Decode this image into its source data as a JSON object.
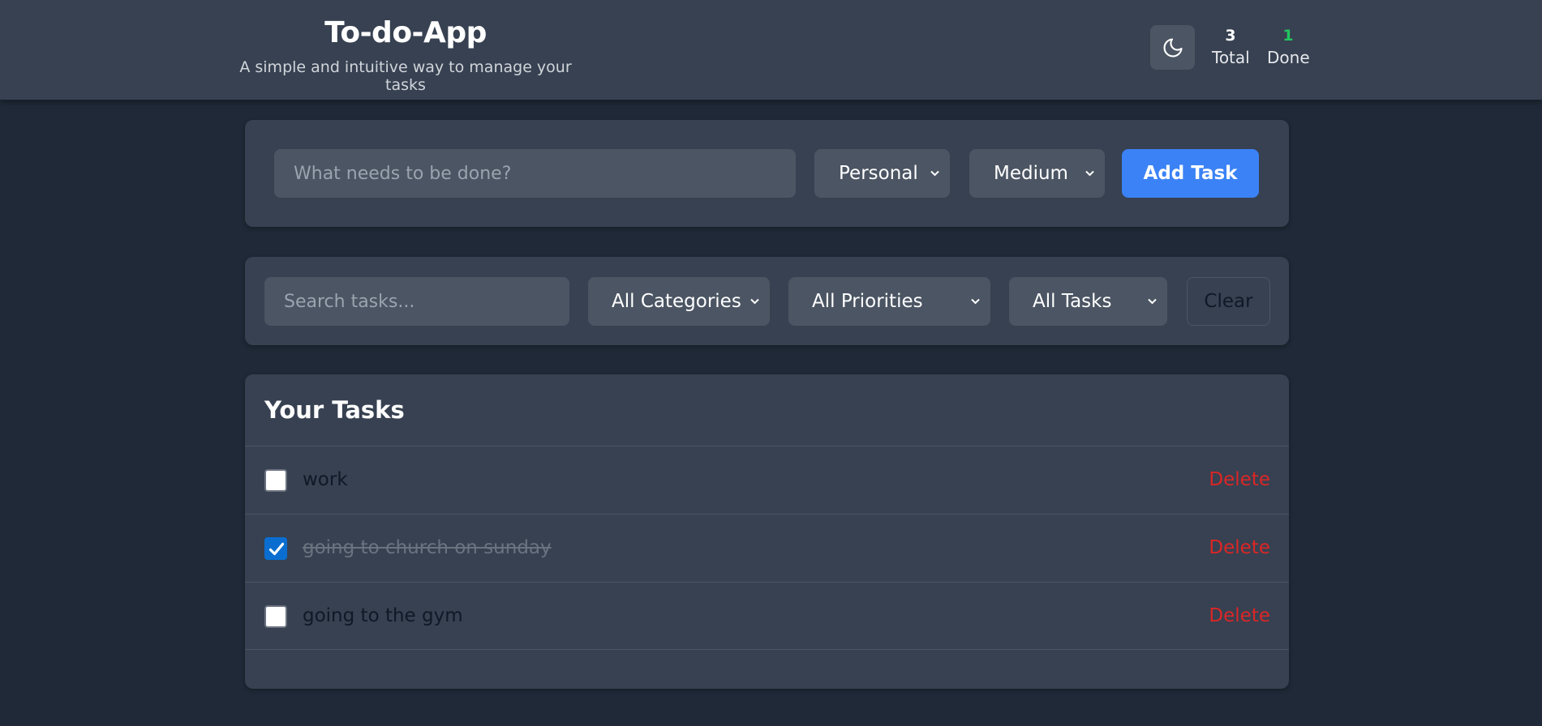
{
  "app": {
    "title": "To-do-App",
    "subtitle": "A simple and intuitive way to manage your tasks"
  },
  "theme_toggle": {
    "icon": "moon-icon"
  },
  "stats": {
    "total_value": "3",
    "total_label": "Total",
    "done_value": "1",
    "done_label": "Done"
  },
  "add_form": {
    "placeholder": "What needs to be done?",
    "category": "Personal",
    "priority": "Medium",
    "add_label": "Add Task"
  },
  "filters": {
    "search_placeholder": "Search tasks...",
    "category": "All Categories",
    "priority": "All Priorities",
    "status": "All Tasks",
    "clear_label": "Clear"
  },
  "tasks": {
    "heading": "Your Tasks",
    "items": [
      {
        "text": "work",
        "done": false,
        "delete_label": "Delete"
      },
      {
        "text": "going to church on sunday",
        "done": true,
        "delete_label": "Delete"
      },
      {
        "text": "going to the gym",
        "done": false,
        "delete_label": "Delete"
      }
    ]
  },
  "colors": {
    "page_bg": "#1f2937",
    "card_bg": "#374151",
    "accent": "#3b82f6",
    "done_stat": "#22c55e",
    "delete": "#dc2626"
  }
}
